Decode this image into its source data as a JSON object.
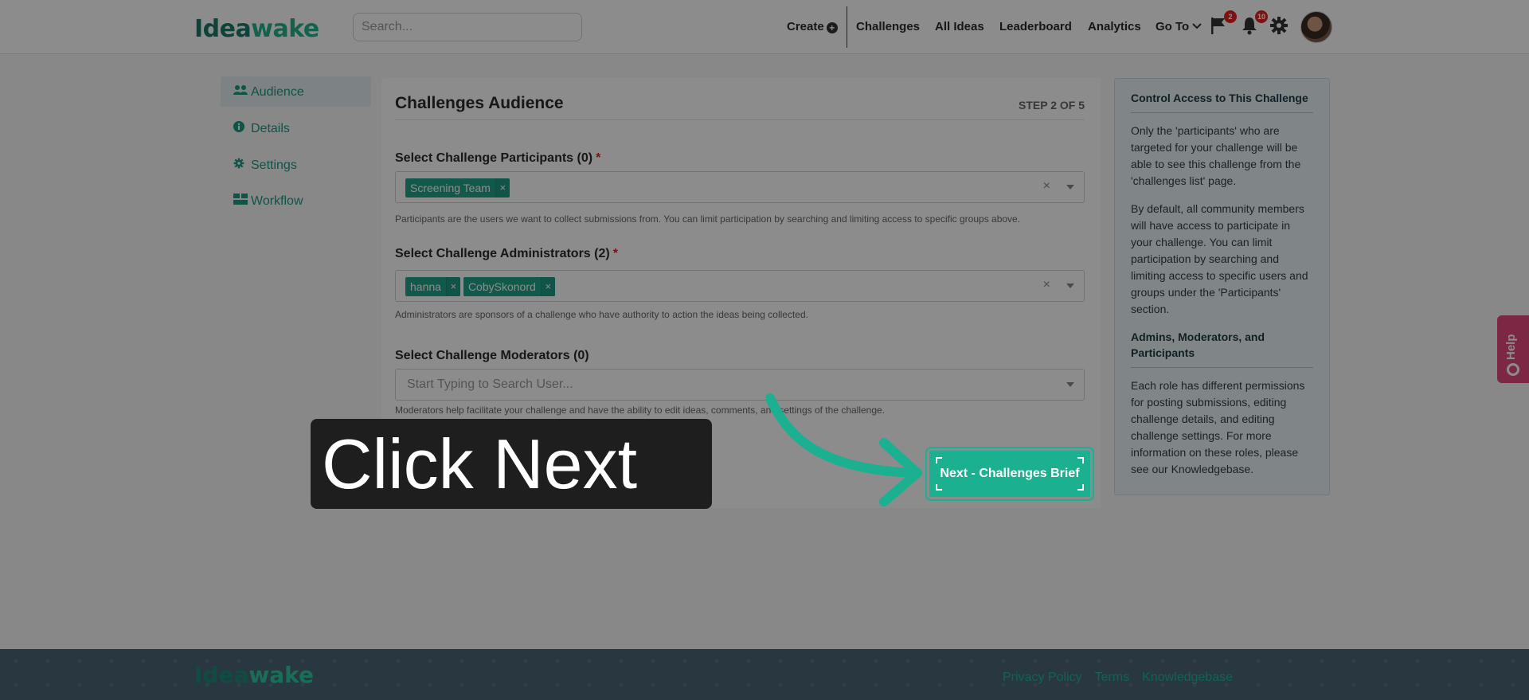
{
  "header": {
    "logo_main": "Idea",
    "logo_accent": "wake",
    "search_placeholder": "Search...",
    "create_label": "Create",
    "nav": [
      "Challenges",
      "All Ideas",
      "Leaderboard",
      "Analytics",
      "Go To"
    ],
    "flag_badge": "2",
    "bell_badge": "10"
  },
  "sidebar": {
    "items": [
      {
        "label": "Audience",
        "icon": "users-icon",
        "active": true
      },
      {
        "label": "Details",
        "icon": "info-icon",
        "active": false
      },
      {
        "label": "Settings",
        "icon": "gear-icon",
        "active": false
      },
      {
        "label": "Workflow",
        "icon": "workflow-icon",
        "active": false
      }
    ]
  },
  "main": {
    "title": "Challenges Audience",
    "step": "STEP 2 OF 5",
    "participants": {
      "label": "Select Challenge Participants (0)",
      "required": "*",
      "tags": [
        "Screening Team"
      ],
      "help": "Participants are the users we want to collect submissions from. You can limit participation by searching and limiting access to specific groups above."
    },
    "administrators": {
      "label": "Select Challenge Administrators (2)",
      "required": "*",
      "tags": [
        "hanna",
        "CobySkonord"
      ],
      "help": "Administrators are sponsors of a challenge who have authority to action the ideas being collected."
    },
    "moderators": {
      "label": "Select Challenge Moderators (0)",
      "placeholder": "Start Typing to Search User...",
      "help": "Moderators help facilitate your challenge and have the ability to edit ideas, comments, and settings of the challenge."
    },
    "tag_remove": "×",
    "clear": "×"
  },
  "panel": {
    "heading1": "Control Access to This Challenge",
    "p1": "Only the 'participants' who are targeted for your challenge will be able to see this challenge from the 'challenges list' page.",
    "p2": "By default, all community members will have access to participate in your challenge. You can limit participation by searching and limiting access to specific users and groups under the 'Participants' section.",
    "heading2": "Admins, Moderators, and Participants",
    "p3": "Each role has different permissions for posting submissions, editing challenge details, and editing challenge settings. For more information on these roles, please see our Knowledgebase."
  },
  "help_tab": "Help",
  "footer": {
    "links": [
      "Privacy Policy",
      "Terms",
      "Knowledgebase"
    ]
  },
  "overlay": {
    "callout": "Click Next",
    "next_button": "Next - Challenges Brief",
    "accent_color": "#1bb090"
  }
}
